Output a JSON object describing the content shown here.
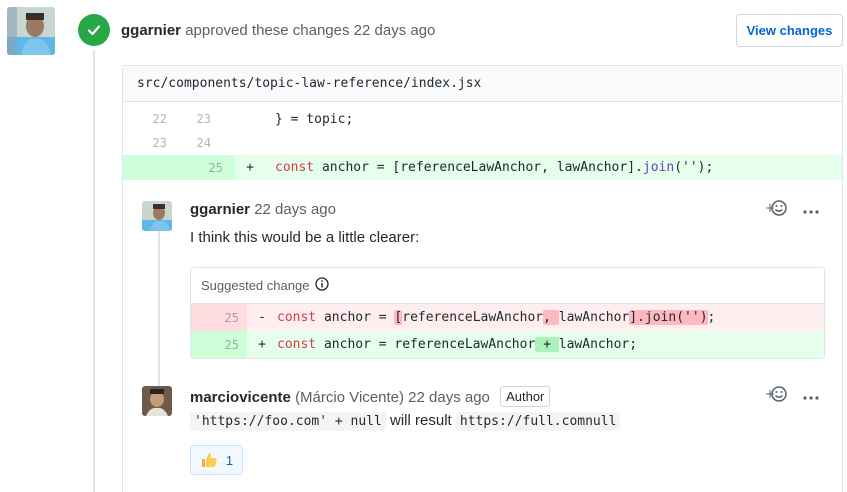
{
  "review_event": {
    "author": "ggarnier",
    "action": "approved these changes",
    "time": "22 days ago",
    "view_changes_label": "View changes"
  },
  "file": {
    "path": "src/components/topic-law-reference/index.jsx",
    "lines": [
      {
        "old": "22",
        "new": "23",
        "sign": "",
        "code_plain": "} = topic;"
      },
      {
        "old": "23",
        "new": "24",
        "sign": "",
        "code_plain": ""
      },
      {
        "old": "",
        "new": "25",
        "sign": "+",
        "code_kw": "const",
        "code_rest": " anchor = [referenceLawAnchor, lawAnchor].",
        "code_fn": "join",
        "code_paren": "(",
        "code_str": "''",
        "code_end": ");"
      }
    ]
  },
  "comments": [
    {
      "author": "ggarnier",
      "time": "22 days ago",
      "body": "I think this would be a little clearer:",
      "suggestion": {
        "title": "Suggested change",
        "del_line": "25",
        "ins_line": "25",
        "del_sign": "-",
        "ins_sign": "+",
        "del_kw": "const",
        "del_pre": " anchor = ",
        "del_hl1": "[",
        "del_mid1": "referenceLawAnchor",
        "del_hl2": ", ",
        "del_mid2": "lawAnchor",
        "del_hl3": "].join('')",
        "del_end": ";",
        "ins_kw": "const",
        "ins_pre": " anchor = referenceLawAnchor",
        "ins_hl": " + ",
        "ins_end": "lawAnchor;"
      }
    },
    {
      "author": "marciovicente",
      "full_name": "(Márcio Vicente)",
      "time": "22 days ago",
      "badge": "Author",
      "code1": "'https://foo.com' + null",
      "middle_text": "will result",
      "code2": "https://full.comnull",
      "reaction_count": "1"
    }
  ],
  "colors": {
    "accent": "#0366d6",
    "approved": "#28a745"
  }
}
